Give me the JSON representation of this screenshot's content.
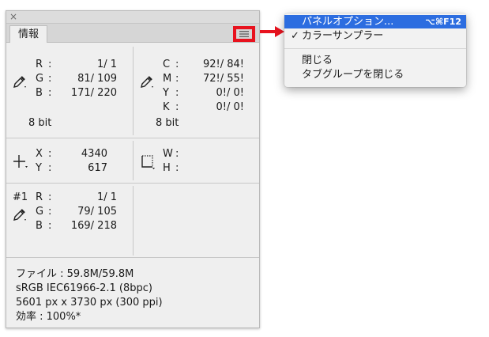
{
  "panel": {
    "close_glyph": "×",
    "tab_label": "情報",
    "rgb1": {
      "labels": [
        "R",
        "G",
        "B"
      ],
      "values": [
        "1/  1",
        "81/ 109",
        "171/ 220"
      ],
      "bit": "8 bit"
    },
    "cmyk": {
      "labels": [
        "C",
        "M",
        "Y",
        "K"
      ],
      "values": [
        "92!/ 84!",
        "72!/ 55!",
        "0!/  0!",
        "0!/  0!"
      ],
      "bit": "8 bit"
    },
    "xy": {
      "labels": [
        "X",
        "Y"
      ],
      "values": [
        "4340",
        "617"
      ]
    },
    "wh": {
      "labels": [
        "W",
        "H"
      ]
    },
    "sampler": {
      "id": "#1",
      "labels": [
        "R",
        "G",
        "B"
      ],
      "values": [
        "1/  1",
        "79/ 105",
        "169/ 218"
      ]
    },
    "file_info": [
      "ファイル : 59.8M/59.8M",
      "sRGB IEC61966-2.1 (8bpc)",
      "5601 px x 3730 px (300 ppi)",
      "効率 : 100%*"
    ]
  },
  "dropdown": {
    "items": [
      {
        "label": "パネルオプション...",
        "shortcut": "⌥⌘F12",
        "highlighted": true
      },
      {
        "label": "カラーサンプラー",
        "checked": true
      },
      {
        "label": "閉じる"
      },
      {
        "label": "タブグループを閉じる"
      }
    ],
    "check_glyph": "✓"
  },
  "colors": {
    "highlight": "#2c6de0",
    "callout_red": "#e8121e"
  }
}
